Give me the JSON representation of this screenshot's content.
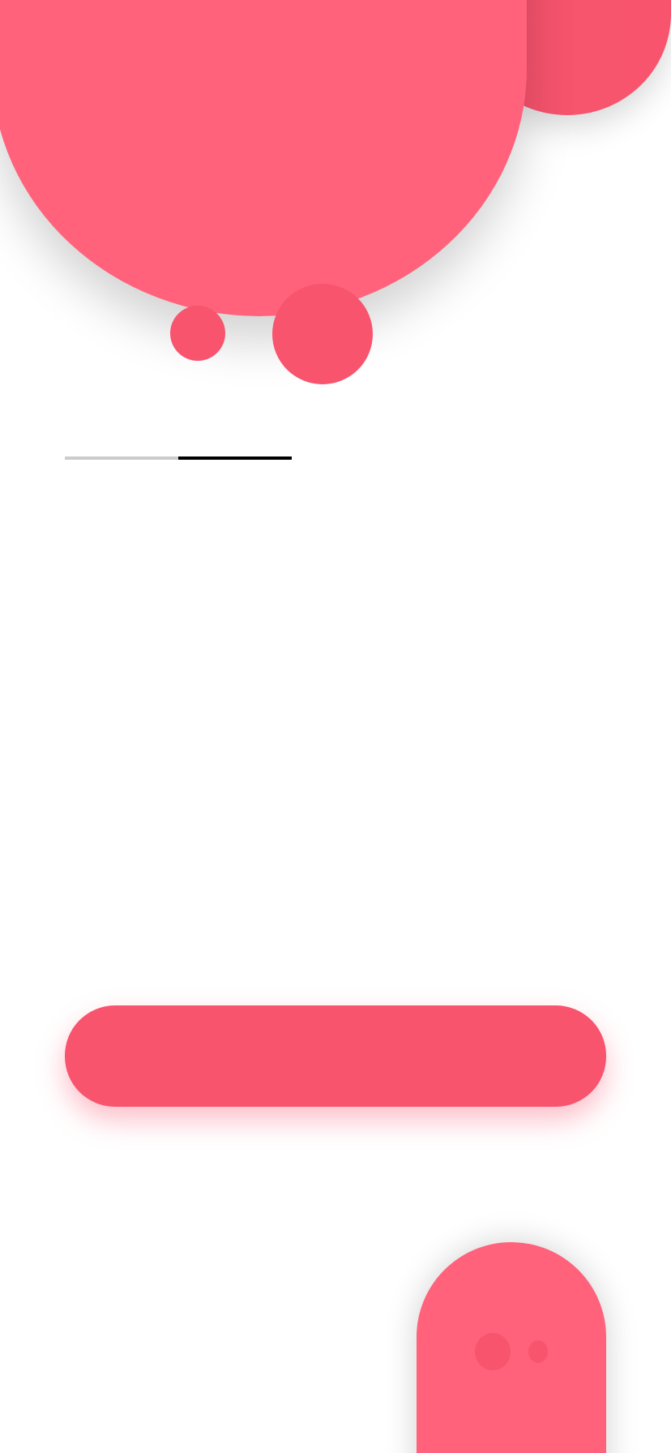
{
  "screen": {
    "background": "#ffffff",
    "accent": "#f8546e",
    "accent_light": "#ff627a"
  },
  "pager": {
    "total": 2,
    "active_index": 1
  },
  "primary_button": {
    "label": ""
  },
  "decorations": {
    "top_character": "pink-blob-character",
    "bottom_character": "pink-blob-mascot"
  }
}
